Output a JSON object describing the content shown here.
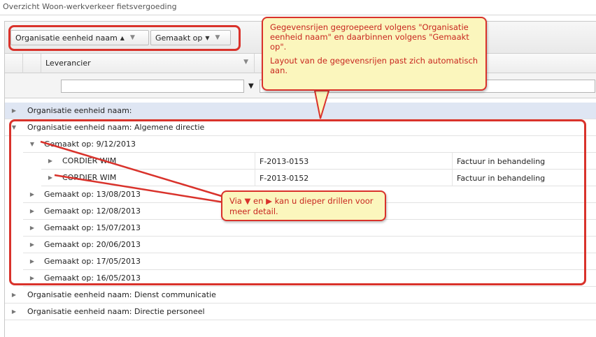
{
  "window": {
    "title": "Overzicht Woon-werkverkeer fietsvergoeding"
  },
  "groupbar": {
    "group1": "Organisatie eenheid naam",
    "group1_sort": "▲",
    "group2": "Gemaakt op",
    "group2_sort": "▼"
  },
  "columns": {
    "leverancier": "Leverancier"
  },
  "callout_top": {
    "line1": "Gegevensrijen gegroepeerd volgens \"Organisatie eenheid naam\" en daarbinnen volgens \"Gemaakt op\".",
    "line2": "Layout van de gegevensrijen past zich automatisch aan."
  },
  "callout_bottom": {
    "pre": "Via ",
    "down": "▼",
    "mid": " en ",
    "right": "▶",
    "post": " kan u dieper drillen voor meer detail."
  },
  "groups": [
    {
      "label": "Organisatie eenheid naam:"
    },
    {
      "label": "Organisatie eenheid naam: Algemene directie"
    },
    {
      "label": "Organisatie eenheid naam: Dienst communicatie"
    },
    {
      "label": "Organisatie eenheid naam: Directie personeel"
    }
  ],
  "subgroups": [
    {
      "label": "Gemaakt op: 9/12/2013"
    },
    {
      "label": "Gemaakt op: 13/08/2013"
    },
    {
      "label": "Gemaakt op: 12/08/2013"
    },
    {
      "label": "Gemaakt op: 15/07/2013"
    },
    {
      "label": "Gemaakt op: 20/06/2013"
    },
    {
      "label": "Gemaakt op: 17/05/2013"
    },
    {
      "label": "Gemaakt op: 16/05/2013"
    }
  ],
  "rows": [
    {
      "name": "CORDIER WIM",
      "ref": "F-2013-0153",
      "status": "Factuur in behandeling"
    },
    {
      "name": "CORDIER WIM",
      "ref": "F-2013-0152",
      "status": "Factuur in behandeling"
    }
  ],
  "colors": {
    "accent": "#d9322b",
    "callout_bg": "#fbf6bd",
    "selected_row": "#dfe6f3"
  }
}
